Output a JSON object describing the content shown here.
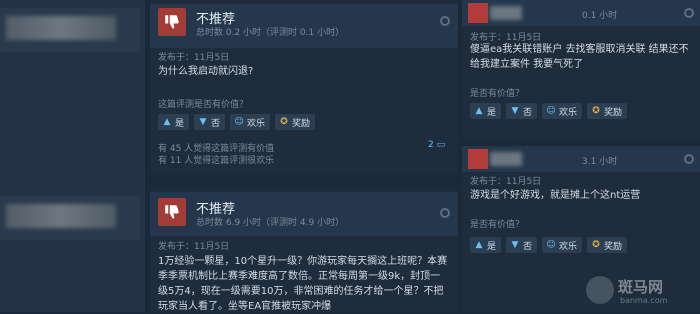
{
  "left_reviews": [
    {
      "verdict": "不推荐",
      "hours": "总时数 0.2 小时（评测时 0.1 小时）",
      "posted": "发布于：11月5日",
      "text": "为什么我启动就闪退?",
      "helpful_question": "这篇评测是否有价值？",
      "buttons": {
        "yes": "是",
        "no": "否",
        "funny": "欢乐",
        "award": "奖励"
      },
      "stat_helpful": "有 45 人觉得这篇评测有价值",
      "stat_funny": "有 11 人觉得这篇评测很欢乐",
      "comments": "2"
    },
    {
      "verdict": "不推荐",
      "hours": "总时数 6.9 小时（评测时 4.9 小时）",
      "posted": "发布于：11月5日",
      "text": "1万经验一颗星，10个星升一级？你游玩家每天搁这上班呢？本赛季季票机制比上赛季难度高了数倍。正常每周第一级9k，封顶一级5万4，现在一级需要10万，非常困难的任务才给一个星？不把玩家当人看了。坐等EA官推被玩家冲爆"
    }
  ],
  "right_reviews": [
    {
      "time": "0.1 小时",
      "posted": "发布于：11月5日",
      "text": "傻逼ea我关联错账户 去找客服取消关联 结果还不给我建立案件 我要气死了",
      "helpful_question": "是否有价值？",
      "buttons": {
        "yes": "是",
        "no": "否",
        "funny": "欢乐",
        "award": "奖励"
      }
    },
    {
      "time": "3.1 小时",
      "posted": "发布于：11月5日",
      "text": "游戏是个好游戏，就是摊上个这nt运营",
      "helpful_question": "是否有价值？",
      "buttons": {
        "yes": "是",
        "no": "否",
        "funny": "欢乐",
        "award": "奖励"
      }
    }
  ],
  "watermark": {
    "brand": "斑马网",
    "site": "banma.com"
  }
}
